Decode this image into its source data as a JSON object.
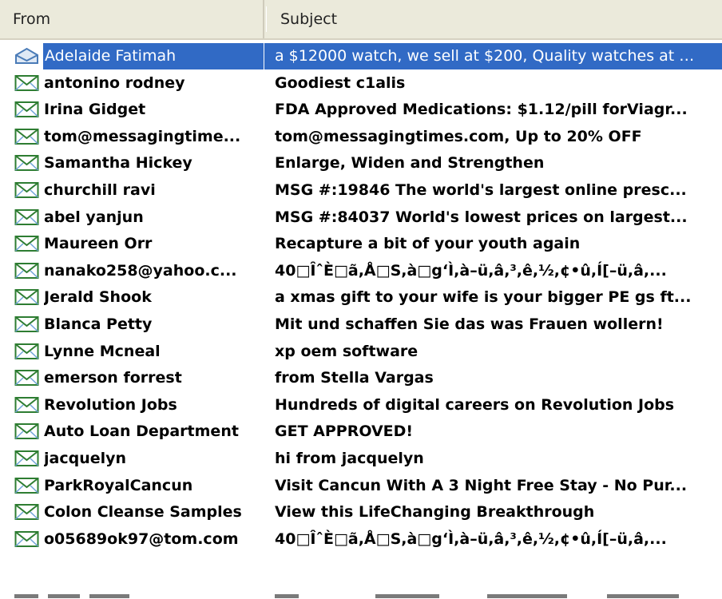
{
  "columns": {
    "from": "From",
    "subject": "Subject"
  },
  "messages": [
    {
      "from": "Adelaide Fatimah",
      "subject": "a $12000 watch, we sell at $200, Quality watches at …",
      "icon": "opened-envelope-icon",
      "selected": true
    },
    {
      "from": "antonino rodney",
      "subject": "Goodiest c1alis",
      "icon": "envelope-icon"
    },
    {
      "from": "Irina Gidget",
      "subject": "FDA Approved Medications: $1.12/pill forViagr...",
      "icon": "envelope-icon"
    },
    {
      "from": "tom@messagingtime...",
      "subject": "tom@messagingtimes.com, Up to 20% OFF",
      "icon": "envelope-icon"
    },
    {
      "from": "Samantha Hickey",
      "subject": "Enlarge, Widen and Strengthen",
      "icon": "envelope-icon"
    },
    {
      "from": "churchill ravi",
      "subject": "MSG #:19846 The world's largest online presc...",
      "icon": "envelope-icon"
    },
    {
      "from": "abel yanjun",
      "subject": "MSG #:84037 World's lowest prices on largest...",
      "icon": "envelope-icon"
    },
    {
      "from": "Maureen Orr",
      "subject": "Recapture a bit of your youth again",
      "icon": "envelope-icon"
    },
    {
      "from": "nanako258@yahoo.c...",
      "subject": "40□ÎˆÈ□ã,Å□S,à□gʻÌ,à–ü,â,³,ê,½,¢•û,Í[–ü,â,...",
      "icon": "envelope-icon"
    },
    {
      "from": "Jerald Shook",
      "subject": "a xmas gift to your wife is your bigger PE gs ft...",
      "icon": "envelope-icon"
    },
    {
      "from": "Blanca Petty",
      "subject": "Mit und schaffen Sie das was Frauen wollern!",
      "icon": "envelope-icon"
    },
    {
      "from": "Lynne Mcneal",
      "subject": "xp oem software",
      "icon": "envelope-icon"
    },
    {
      "from": "emerson forrest",
      "subject": "from Stella Vargas",
      "icon": "envelope-icon"
    },
    {
      "from": "Revolution Jobs",
      "subject": "Hundreds of digital careers on Revolution Jobs",
      "icon": "envelope-icon"
    },
    {
      "from": "Auto Loan Department",
      "subject": "GET APPROVED!",
      "icon": "envelope-icon"
    },
    {
      "from": "jacquelyn",
      "subject": "hi from jacquelyn",
      "icon": "envelope-icon"
    },
    {
      "from": "ParkRoyalCancun",
      "subject": "Visit Cancun With A 3 Night Free Stay - No Pur...",
      "icon": "envelope-icon"
    },
    {
      "from": "Colon Cleanse Samples",
      "subject": "View this LifeChanging Breakthrough",
      "icon": "envelope-icon"
    },
    {
      "from": "o05689ok97@tom.com",
      "subject": "40□ÎˆÈ□ã,Å□S,à□gʻÌ,à–ü,â,³,ê,½,¢•û,Í[–ü,â,...",
      "icon": "envelope-icon"
    }
  ],
  "colors": {
    "selection": "#316ac5",
    "header_bg": "#ebeadb",
    "icon_green": "#2e7d32",
    "icon_blue": "#6fa3d8"
  }
}
